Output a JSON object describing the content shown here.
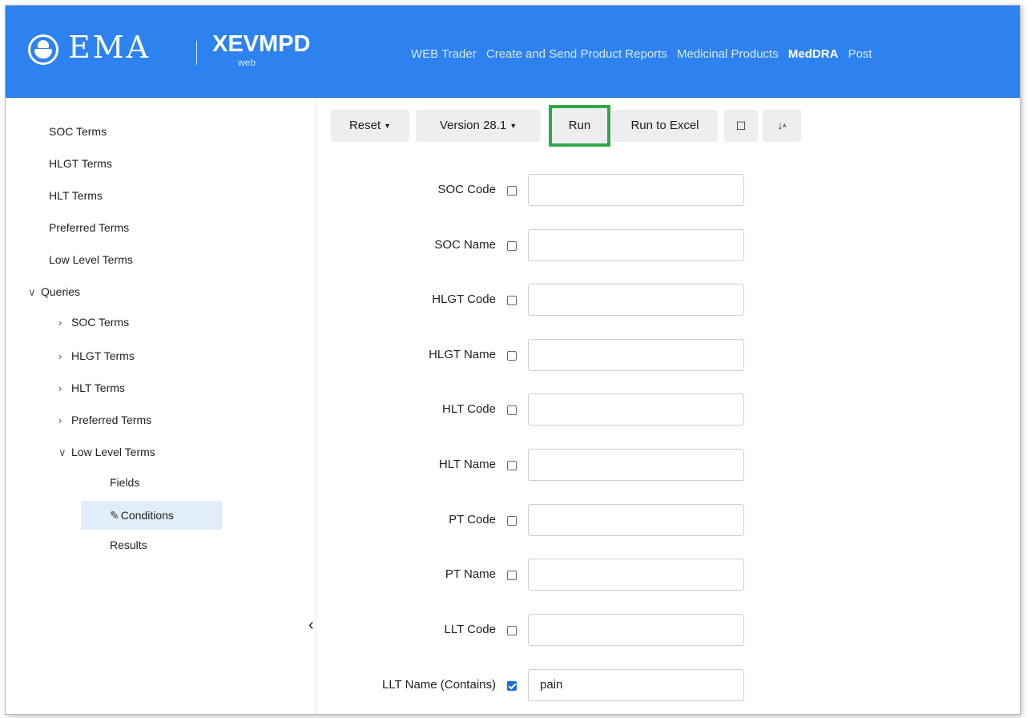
{
  "header": {
    "logo_text": "EMA",
    "product": "XEVMPD",
    "product_sub": "web",
    "nav": [
      "WEB Trader",
      "Create and Send Product Reports",
      "Medicinal Products",
      "MedDRA",
      "Post"
    ],
    "active_nav": "MedDRA"
  },
  "sidebar": {
    "items": [
      {
        "label": "SOC Terms"
      },
      {
        "label": "HLGT Terms"
      },
      {
        "label": "HLT Terms"
      },
      {
        "label": "Preferred Terms"
      },
      {
        "label": "Low Level Terms"
      },
      {
        "label": "Queries",
        "chevron": "∨"
      },
      {
        "label": "SOC Terms",
        "chevron": "›"
      },
      {
        "label": "HLGT Terms",
        "chevron": "›"
      },
      {
        "label": "HLT Terms",
        "chevron": "›"
      },
      {
        "label": "Preferred Terms",
        "chevron": "›"
      },
      {
        "label": "Low Level Terms",
        "chevron": "∨"
      },
      {
        "label": "Fields"
      },
      {
        "label": "Conditions",
        "selected": true
      },
      {
        "label": "Results"
      }
    ],
    "collapse_glyph": "‹"
  },
  "toolbar": {
    "reset": "Reset",
    "version": "Version 28.1",
    "run": "Run",
    "run_excel": "Run to Excel",
    "square_glyph": "☐",
    "sort_glyph": "↓"
  },
  "form": {
    "fields": [
      {
        "label": "SOC Code",
        "checked": false,
        "value": ""
      },
      {
        "label": "SOC Name",
        "checked": false,
        "value": ""
      },
      {
        "label": "HLGT Code",
        "checked": false,
        "value": ""
      },
      {
        "label": "HLGT Name",
        "checked": false,
        "value": ""
      },
      {
        "label": "HLT Code",
        "checked": false,
        "value": ""
      },
      {
        "label": "HLT Name",
        "checked": false,
        "value": ""
      },
      {
        "label": "PT Code",
        "checked": false,
        "value": ""
      },
      {
        "label": "PT Name",
        "checked": false,
        "value": ""
      },
      {
        "label": "LLT Code",
        "checked": false,
        "value": ""
      },
      {
        "label": "LLT Name (Contains)",
        "checked": true,
        "value": "pain"
      }
    ]
  },
  "colors": {
    "header_bg": "#2d82ef",
    "highlight": "#2fa84b",
    "selected_bg": "#e1eefa"
  }
}
